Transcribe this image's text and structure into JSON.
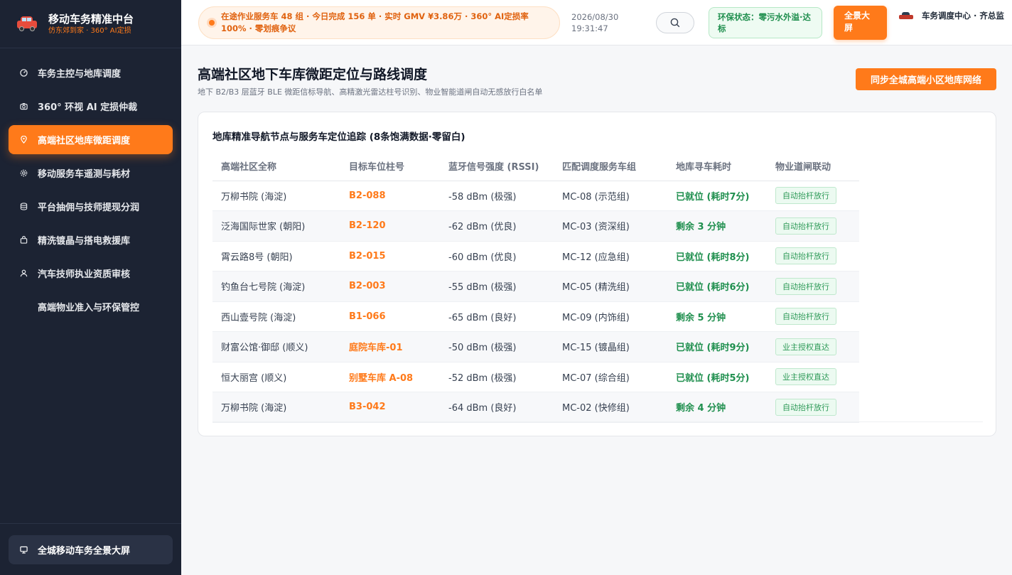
{
  "brand": {
    "title": "移动车务精准中台",
    "subtitle": "仿东郊到家 · 360° AI定损"
  },
  "sidebar": {
    "items": [
      {
        "label": "车务主控与地库调度",
        "icon": "dashboard-icon",
        "active": false
      },
      {
        "label": "360° 环视 AI 定损仲裁",
        "icon": "camera-icon",
        "active": false
      },
      {
        "label": "高端社区地库微距调度",
        "icon": "location-pin-icon",
        "active": true
      },
      {
        "label": "移动服务车遥测与耗材",
        "icon": "gear-icon",
        "active": false
      },
      {
        "label": "平台抽佣与技师提现分润",
        "icon": "database-icon",
        "active": false
      },
      {
        "label": "精洗镀晶与搭电救援库",
        "icon": "bag-icon",
        "active": false
      },
      {
        "label": "汽车技师执业资质审核",
        "icon": "user-icon",
        "active": false
      },
      {
        "label": "高端物业准入与环保管控",
        "icon": "",
        "active": false
      }
    ],
    "footer_label": "全城移动车务全景大屏"
  },
  "header": {
    "ticker": "在途作业服务车 48 组 · 今日完成 156 单 · 实时 GMV ¥3.86万 · 360° AI定损率 100% · 零划痕争议",
    "date": "2026/08/30",
    "time": "19:31:47",
    "env_status": "环保状态：零污水外溢·达标",
    "fullscreen_label": "全景大屏",
    "user_name": "车务调度中心 · 齐总监"
  },
  "main": {
    "title": "高端社区地下车库微距定位与路线调度",
    "subtitle": "地下 B2/B3 层蓝牙 BLE 微距信标导航、高精激光雷达柱号识别、物业智能道闸自动无感放行白名单",
    "sync_label": "同步全城高端小区地库网络",
    "card_title": "地库精准导航节点与服务车定位追踪 (8条饱满数据·零留白)",
    "columns": [
      "高端社区全称",
      "目标车位柱号",
      "蓝牙信号强度 (RSSI)",
      "匹配调度服务车组",
      "地库寻车耗时",
      "物业道闸联动"
    ],
    "rows": [
      {
        "community": "万柳书院 (海淀)",
        "slot": "B2-088",
        "rssi": "-58 dBm (极强)",
        "team": "MC-08 (示范组)",
        "eta": "已就位 (耗时7分)",
        "gate": "自动抬杆放行"
      },
      {
        "community": "泛海国际世家 (朝阳)",
        "slot": "B2-120",
        "rssi": "-62 dBm (优良)",
        "team": "MC-03 (资深组)",
        "eta": "剩余 3 分钟",
        "gate": "自动抬杆放行"
      },
      {
        "community": "霄云路8号 (朝阳)",
        "slot": "B2-015",
        "rssi": "-60 dBm (优良)",
        "team": "MC-12 (应急组)",
        "eta": "已就位 (耗时8分)",
        "gate": "自动抬杆放行"
      },
      {
        "community": "钓鱼台七号院 (海淀)",
        "slot": "B2-003",
        "rssi": "-55 dBm (极强)",
        "team": "MC-05 (精洗组)",
        "eta": "已就位 (耗时6分)",
        "gate": "自动抬杆放行"
      },
      {
        "community": "西山壹号院 (海淀)",
        "slot": "B1-066",
        "rssi": "-65 dBm (良好)",
        "team": "MC-09 (内饰组)",
        "eta": "剩余 5 分钟",
        "gate": "自动抬杆放行"
      },
      {
        "community": "财富公馆·御邸 (顺义)",
        "slot": "庭院车库-01",
        "rssi": "-50 dBm (极强)",
        "team": "MC-15 (镀晶组)",
        "eta": "已就位 (耗时9分)",
        "gate": "业主授权直达"
      },
      {
        "community": "恒大丽宫 (顺义)",
        "slot": "别墅车库 A-08",
        "rssi": "-52 dBm (极强)",
        "team": "MC-07 (综合组)",
        "eta": "已就位 (耗时5分)",
        "gate": "业主授权直达"
      },
      {
        "community": "万柳书院 (海淀)",
        "slot": "B3-042",
        "rssi": "-64 dBm (良好)",
        "team": "MC-02 (快修组)",
        "eta": "剩余 4 分钟",
        "gate": "自动抬杆放行"
      }
    ]
  },
  "colors": {
    "accent": "#ff7a1a",
    "sidebar_bg": "#1c2333",
    "success": "#1f8f4e"
  }
}
